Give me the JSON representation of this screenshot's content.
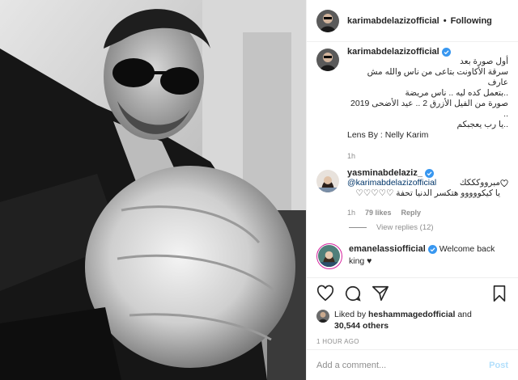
{
  "header": {
    "username": "karimabdelazizofficial",
    "separator": "•",
    "follow_label": "Following"
  },
  "caption": {
    "username": "karimabdelazizofficial",
    "lines": [
      "أول صورة بعد",
      "سرقة الأكاونت بتاعى من ناس والله مش عارف",
      "..بتعمل كده ليه .. ناس مريضة",
      "صورة من الفيل الأزرق 2 .. عيد الأضحى 2019 ..",
      "..يا رب يعجبكم"
    ],
    "credit": "Lens By : Nelly Karim",
    "time": "1h"
  },
  "comments": [
    {
      "username": "yasminabdelaziz_",
      "mention": "@karimabdelazizofficial",
      "text_after_mention": "مبرووكككك",
      "line2": "يا كيكووووو هتكسر الدنيا تحفة ♡♡♡♡♡",
      "time": "1h",
      "likes": "79 likes",
      "reply_label": "Reply",
      "view_replies": "View replies (12)"
    },
    {
      "username": "emanelassiofficial",
      "text": "Welcome back king ♥"
    }
  ],
  "likes": {
    "prefix": "Liked by",
    "user": "heshammagedofficial",
    "and": "and",
    "others": "30,544 others"
  },
  "timestamp": "1 HOUR AGO",
  "add_comment": {
    "placeholder": "Add a comment...",
    "post_label": "Post"
  },
  "colors": {
    "verified": "#3897f0",
    "post_disabled": "#b2dffc",
    "story_ring": "#d6249f"
  },
  "icons": [
    "heart-icon",
    "comment-icon",
    "share-icon",
    "bookmark-icon",
    "verified-badge-icon"
  ]
}
